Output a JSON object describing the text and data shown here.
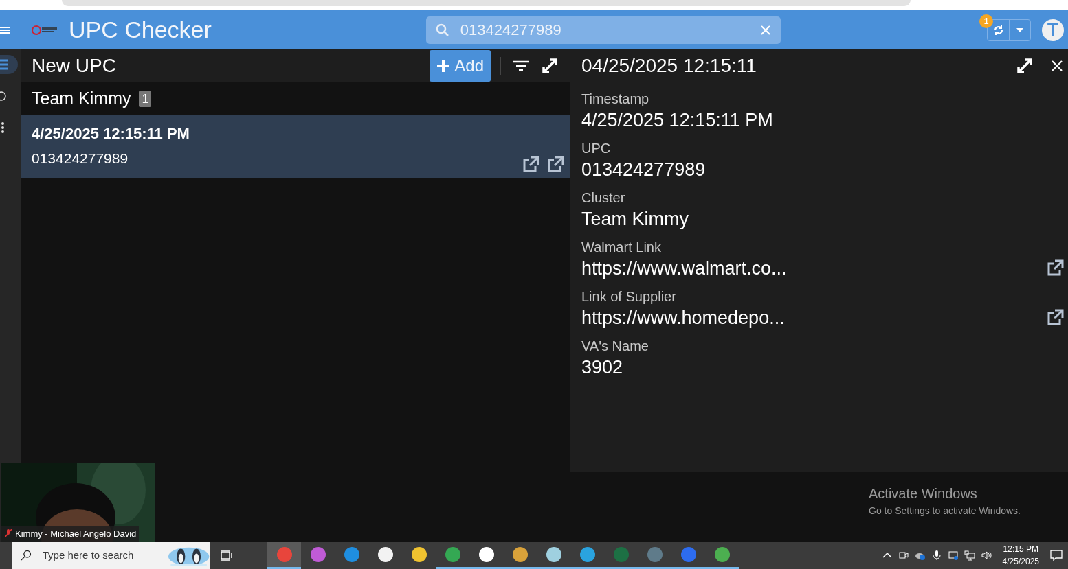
{
  "header": {
    "title": "UPC Checker",
    "search": {
      "value": "013424277989"
    },
    "sync_badge": "1",
    "avatar": "T"
  },
  "rail": [
    {
      "kind": "list",
      "selected": true
    },
    {
      "kind": "circle",
      "selected": false
    },
    {
      "kind": "dots",
      "selected": false
    }
  ],
  "list_panel": {
    "title": "New UPC",
    "add_button": "Add",
    "group": {
      "name": "Team Kimmy",
      "count": "1"
    },
    "items": [
      {
        "timestamp": "4/25/2025 12:15:11 PM",
        "upc": "013424277989",
        "selected": true
      }
    ]
  },
  "detail": {
    "title": "04/25/2025 12:15:11",
    "fields": [
      {
        "label": "Timestamp",
        "value": "4/25/2025 12:15:11 PM",
        "kind": "text"
      },
      {
        "label": "UPC",
        "value": "013424277989",
        "kind": "text"
      },
      {
        "label": "Cluster",
        "value": "Team Kimmy",
        "kind": "text"
      },
      {
        "label": "Walmart Link",
        "value": "https://www.walmart.co...",
        "kind": "link"
      },
      {
        "label": "Link of Supplier",
        "value": "https://www.homedepo...",
        "kind": "link"
      },
      {
        "label": "VA's Name",
        "value": "3902",
        "kind": "text"
      }
    ]
  },
  "activation": {
    "title": "Activate Windows",
    "text": "Go to Settings to activate Windows."
  },
  "video": {
    "name": "Kimmy - Michael Angelo David",
    "muted": true
  },
  "taskbar": {
    "search_placeholder": "Type here to search",
    "apps": [
      {
        "color": "#e8453c",
        "selected": true,
        "running": true
      },
      {
        "color": "#c05bd6",
        "selected": false,
        "running": false
      },
      {
        "color": "#1f8ee0",
        "selected": false,
        "running": false
      },
      {
        "color": "#f2f2f2",
        "selected": false,
        "running": false
      },
      {
        "color": "#f0c330",
        "selected": false,
        "running": false
      },
      {
        "color": "#34a853",
        "selected": false,
        "running": true
      },
      {
        "color": "#ffffff",
        "selected": false,
        "running": true
      },
      {
        "color": "#d9a23a",
        "selected": false,
        "running": true
      },
      {
        "color": "#9fd0e0",
        "selected": false,
        "running": true
      },
      {
        "color": "#2aa3df",
        "selected": false,
        "running": true
      },
      {
        "color": "#1d7044",
        "selected": false,
        "running": true
      },
      {
        "color": "#5f7b8a",
        "selected": false,
        "running": true
      },
      {
        "color": "#2d6cf0",
        "selected": false,
        "running": true
      },
      {
        "color": "#4caf50",
        "selected": false,
        "running": true
      }
    ],
    "time": "12:15 PM",
    "date": "4/25/2025"
  }
}
